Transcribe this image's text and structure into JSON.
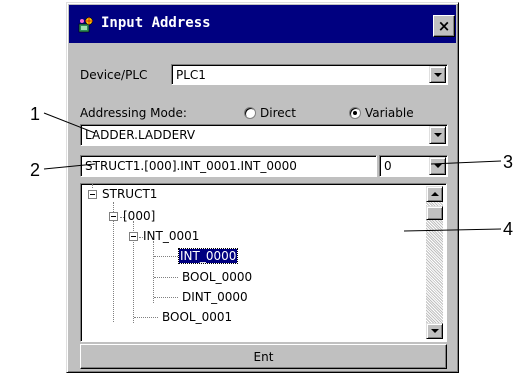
{
  "window": {
    "title": "Input Address",
    "close_glyph": "×",
    "icon": "app-icon"
  },
  "device": {
    "label": "Device/PLC",
    "value": "PLC1"
  },
  "addressing": {
    "label": "Addressing Mode:",
    "options": [
      {
        "label": "Direct",
        "selected": false
      },
      {
        "label": "Variable",
        "selected": true
      }
    ],
    "value": "LADDER.LADDERV"
  },
  "address": {
    "value": "STRUCT1.[000].INT_0001.INT_0000",
    "index": "0"
  },
  "tree": {
    "nodes": [
      {
        "label": "STRUCT1"
      },
      {
        "label": "[000]"
      },
      {
        "label": "INT_0001"
      },
      {
        "label": "INT_0000"
      },
      {
        "label": "BOOL_0000"
      },
      {
        "label": "DINT_0000"
      },
      {
        "label": "BOOL_0001"
      }
    ]
  },
  "buttons": {
    "ent": "Ent"
  },
  "callouts": [
    "1",
    "2",
    "3",
    "4"
  ],
  "colors": {
    "titlebar": "#000080",
    "face": "#c0c0c0",
    "selection": "#000080"
  }
}
